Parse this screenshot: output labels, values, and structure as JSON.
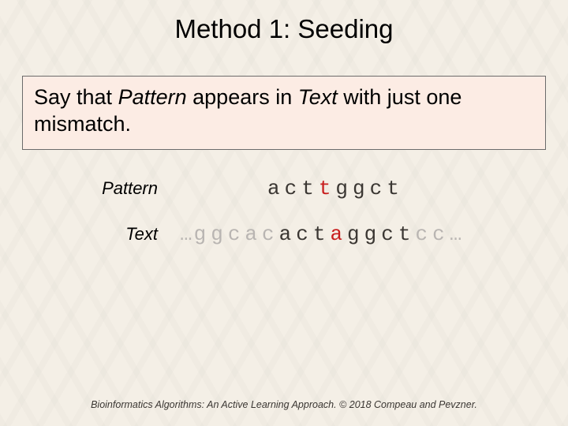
{
  "title": "Method 1: Seeding",
  "callout": {
    "prefix": "Say that ",
    "pattern_word": "Pattern",
    "mid1": " appears in ",
    "text_word": "Text",
    "suffix": " with just one mismatch."
  },
  "labels": {
    "pattern": "Pattern",
    "text": "Text"
  },
  "pattern_seq": [
    {
      "t": "act",
      "c": "c-blk"
    },
    {
      "t": "t",
      "c": "c-red"
    },
    {
      "t": "ggct",
      "c": "c-blk"
    }
  ],
  "text_seq": {
    "lead_ellipsis": "…",
    "segments": [
      {
        "t": "ggcac",
        "c": "c-gray"
      },
      {
        "t": "act",
        "c": "c-blk"
      },
      {
        "t": "a",
        "c": "c-red"
      },
      {
        "t": "ggct",
        "c": "c-blk"
      },
      {
        "t": "cc",
        "c": "c-gray"
      }
    ],
    "trail_ellipsis": "…"
  },
  "footer": "Bioinformatics Algorithms: An Active Learning Approach. © 2018 Compeau and Pevzner."
}
